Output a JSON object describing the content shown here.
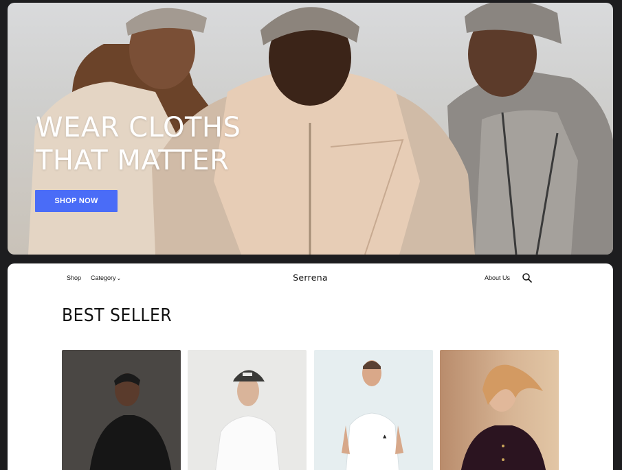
{
  "hero": {
    "title_line1": "WEAR CLOTHS",
    "title_line2": "THAT MATTER",
    "cta_label": "SHOP NOW",
    "cta_color": "#4a6cf7"
  },
  "nav": {
    "shop": "Shop",
    "category": "Category",
    "category_icon": "chevron-down-icon",
    "brand": "Serrena",
    "about": "About Us",
    "search_icon": "search-icon"
  },
  "section": {
    "title": "BEST SELLER"
  },
  "products": [
    {
      "image": "man-black-sweater"
    },
    {
      "image": "man-white-tshirt-cap"
    },
    {
      "image": "man-white-adidas-tshirt"
    },
    {
      "image": "woman-dark-cardigan"
    }
  ]
}
